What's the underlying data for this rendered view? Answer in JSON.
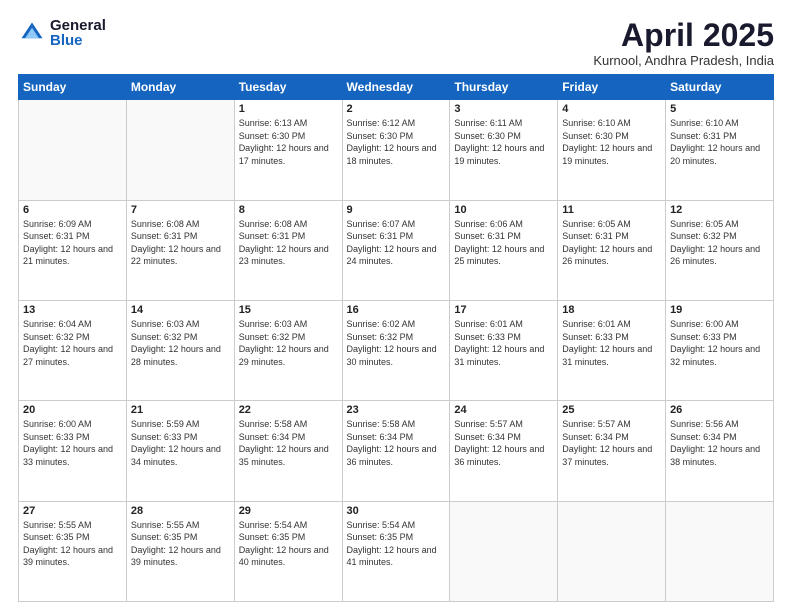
{
  "header": {
    "logo_general": "General",
    "logo_blue": "Blue",
    "title": "April 2025",
    "location": "Kurnool, Andhra Pradesh, India"
  },
  "days_of_week": [
    "Sunday",
    "Monday",
    "Tuesday",
    "Wednesday",
    "Thursday",
    "Friday",
    "Saturday"
  ],
  "weeks": [
    [
      {
        "day": "",
        "sunrise": "",
        "sunset": "",
        "daylight": ""
      },
      {
        "day": "",
        "sunrise": "",
        "sunset": "",
        "daylight": ""
      },
      {
        "day": "1",
        "sunrise": "Sunrise: 6:13 AM",
        "sunset": "Sunset: 6:30 PM",
        "daylight": "Daylight: 12 hours and 17 minutes."
      },
      {
        "day": "2",
        "sunrise": "Sunrise: 6:12 AM",
        "sunset": "Sunset: 6:30 PM",
        "daylight": "Daylight: 12 hours and 18 minutes."
      },
      {
        "day": "3",
        "sunrise": "Sunrise: 6:11 AM",
        "sunset": "Sunset: 6:30 PM",
        "daylight": "Daylight: 12 hours and 19 minutes."
      },
      {
        "day": "4",
        "sunrise": "Sunrise: 6:10 AM",
        "sunset": "Sunset: 6:30 PM",
        "daylight": "Daylight: 12 hours and 19 minutes."
      },
      {
        "day": "5",
        "sunrise": "Sunrise: 6:10 AM",
        "sunset": "Sunset: 6:31 PM",
        "daylight": "Daylight: 12 hours and 20 minutes."
      }
    ],
    [
      {
        "day": "6",
        "sunrise": "Sunrise: 6:09 AM",
        "sunset": "Sunset: 6:31 PM",
        "daylight": "Daylight: 12 hours and 21 minutes."
      },
      {
        "day": "7",
        "sunrise": "Sunrise: 6:08 AM",
        "sunset": "Sunset: 6:31 PM",
        "daylight": "Daylight: 12 hours and 22 minutes."
      },
      {
        "day": "8",
        "sunrise": "Sunrise: 6:08 AM",
        "sunset": "Sunset: 6:31 PM",
        "daylight": "Daylight: 12 hours and 23 minutes."
      },
      {
        "day": "9",
        "sunrise": "Sunrise: 6:07 AM",
        "sunset": "Sunset: 6:31 PM",
        "daylight": "Daylight: 12 hours and 24 minutes."
      },
      {
        "day": "10",
        "sunrise": "Sunrise: 6:06 AM",
        "sunset": "Sunset: 6:31 PM",
        "daylight": "Daylight: 12 hours and 25 minutes."
      },
      {
        "day": "11",
        "sunrise": "Sunrise: 6:05 AM",
        "sunset": "Sunset: 6:31 PM",
        "daylight": "Daylight: 12 hours and 26 minutes."
      },
      {
        "day": "12",
        "sunrise": "Sunrise: 6:05 AM",
        "sunset": "Sunset: 6:32 PM",
        "daylight": "Daylight: 12 hours and 26 minutes."
      }
    ],
    [
      {
        "day": "13",
        "sunrise": "Sunrise: 6:04 AM",
        "sunset": "Sunset: 6:32 PM",
        "daylight": "Daylight: 12 hours and 27 minutes."
      },
      {
        "day": "14",
        "sunrise": "Sunrise: 6:03 AM",
        "sunset": "Sunset: 6:32 PM",
        "daylight": "Daylight: 12 hours and 28 minutes."
      },
      {
        "day": "15",
        "sunrise": "Sunrise: 6:03 AM",
        "sunset": "Sunset: 6:32 PM",
        "daylight": "Daylight: 12 hours and 29 minutes."
      },
      {
        "day": "16",
        "sunrise": "Sunrise: 6:02 AM",
        "sunset": "Sunset: 6:32 PM",
        "daylight": "Daylight: 12 hours and 30 minutes."
      },
      {
        "day": "17",
        "sunrise": "Sunrise: 6:01 AM",
        "sunset": "Sunset: 6:33 PM",
        "daylight": "Daylight: 12 hours and 31 minutes."
      },
      {
        "day": "18",
        "sunrise": "Sunrise: 6:01 AM",
        "sunset": "Sunset: 6:33 PM",
        "daylight": "Daylight: 12 hours and 31 minutes."
      },
      {
        "day": "19",
        "sunrise": "Sunrise: 6:00 AM",
        "sunset": "Sunset: 6:33 PM",
        "daylight": "Daylight: 12 hours and 32 minutes."
      }
    ],
    [
      {
        "day": "20",
        "sunrise": "Sunrise: 6:00 AM",
        "sunset": "Sunset: 6:33 PM",
        "daylight": "Daylight: 12 hours and 33 minutes."
      },
      {
        "day": "21",
        "sunrise": "Sunrise: 5:59 AM",
        "sunset": "Sunset: 6:33 PM",
        "daylight": "Daylight: 12 hours and 34 minutes."
      },
      {
        "day": "22",
        "sunrise": "Sunrise: 5:58 AM",
        "sunset": "Sunset: 6:34 PM",
        "daylight": "Daylight: 12 hours and 35 minutes."
      },
      {
        "day": "23",
        "sunrise": "Sunrise: 5:58 AM",
        "sunset": "Sunset: 6:34 PM",
        "daylight": "Daylight: 12 hours and 36 minutes."
      },
      {
        "day": "24",
        "sunrise": "Sunrise: 5:57 AM",
        "sunset": "Sunset: 6:34 PM",
        "daylight": "Daylight: 12 hours and 36 minutes."
      },
      {
        "day": "25",
        "sunrise": "Sunrise: 5:57 AM",
        "sunset": "Sunset: 6:34 PM",
        "daylight": "Daylight: 12 hours and 37 minutes."
      },
      {
        "day": "26",
        "sunrise": "Sunrise: 5:56 AM",
        "sunset": "Sunset: 6:34 PM",
        "daylight": "Daylight: 12 hours and 38 minutes."
      }
    ],
    [
      {
        "day": "27",
        "sunrise": "Sunrise: 5:55 AM",
        "sunset": "Sunset: 6:35 PM",
        "daylight": "Daylight: 12 hours and 39 minutes."
      },
      {
        "day": "28",
        "sunrise": "Sunrise: 5:55 AM",
        "sunset": "Sunset: 6:35 PM",
        "daylight": "Daylight: 12 hours and 39 minutes."
      },
      {
        "day": "29",
        "sunrise": "Sunrise: 5:54 AM",
        "sunset": "Sunset: 6:35 PM",
        "daylight": "Daylight: 12 hours and 40 minutes."
      },
      {
        "day": "30",
        "sunrise": "Sunrise: 5:54 AM",
        "sunset": "Sunset: 6:35 PM",
        "daylight": "Daylight: 12 hours and 41 minutes."
      },
      {
        "day": "",
        "sunrise": "",
        "sunset": "",
        "daylight": ""
      },
      {
        "day": "",
        "sunrise": "",
        "sunset": "",
        "daylight": ""
      },
      {
        "day": "",
        "sunrise": "",
        "sunset": "",
        "daylight": ""
      }
    ]
  ]
}
